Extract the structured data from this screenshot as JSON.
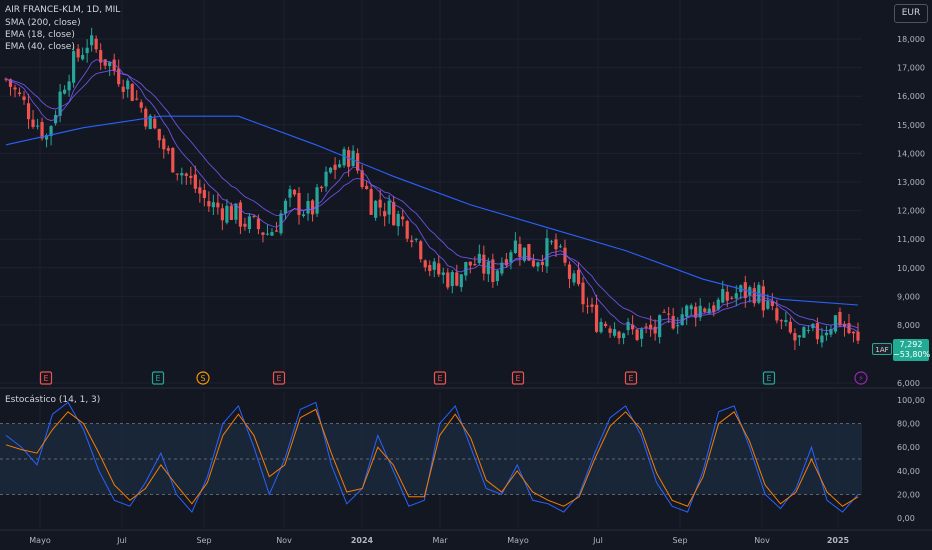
{
  "header": {
    "symbol_line": "AIR FRANCE-KLM, 1D, MIL",
    "indicators": [
      "SMA (200, close)",
      "EMA (18, close)",
      "EMA (40, close)"
    ],
    "currency_button": "EUR"
  },
  "price_tag": {
    "symbol": "1AF",
    "last_price": "7,292",
    "change": "−53,80%",
    "color": "#22ab94"
  },
  "oscillator": {
    "title": "Estocástico (14, 1, 3)",
    "bands": [
      80,
      50,
      20
    ],
    "axis_labels": [
      "100,00",
      "80,00",
      "60,00",
      "40,00",
      "20,00",
      "0,00"
    ]
  },
  "colors": {
    "background": "#131722",
    "up": "#26a69a",
    "down": "#ef5350",
    "sma200": "#2962ff",
    "ema": "#7b5cff",
    "stoch_k": "#2962ff",
    "stoch_d": "#f57c00",
    "band_fill": "#1c2a3f"
  },
  "events": [
    {
      "label": "E",
      "kind": "earnings-red",
      "date": "Jun 2023"
    },
    {
      "label": "E",
      "kind": "earnings-green",
      "date": "Jul 2023"
    },
    {
      "label": "S",
      "kind": "split",
      "date": "Aug 2023"
    },
    {
      "label": "E",
      "kind": "earnings-red",
      "date": "Oct 2023"
    },
    {
      "label": "E",
      "kind": "earnings-red",
      "date": "Feb 2024"
    },
    {
      "label": "E",
      "kind": "earnings-red",
      "date": "Apr 2024"
    },
    {
      "label": "E",
      "kind": "earnings-red",
      "date": "Jul 2024"
    },
    {
      "label": "E",
      "kind": "earnings-green",
      "date": "Oct 2024"
    },
    {
      "label": "⚡",
      "kind": "upcoming",
      "date": "Jan 2025"
    }
  ],
  "chart_data": [
    {
      "type": "candlestick",
      "title": "AIR FRANCE-KLM, 1D, MIL",
      "x_ticks": [
        "Mayo",
        "Jul",
        "Sep",
        "Nov",
        "2024",
        "Mar",
        "Mayo",
        "Jul",
        "Sep",
        "Nov",
        "2025"
      ],
      "y_ticks": [
        "18,000",
        "17,000",
        "16,000",
        "15,000",
        "14,000",
        "13,000",
        "12,000",
        "11,000",
        "10,000",
        "9,000",
        "8,000",
        "6,000"
      ],
      "ylim": [
        6,
        18.6
      ],
      "close_points": [
        {
          "month": "2023-04",
          "close": 16.6
        },
        {
          "month": "2023-04b",
          "close": 15.6
        },
        {
          "month": "2023-05",
          "close": 14.6
        },
        {
          "month": "2023-05b",
          "close": 16.8
        },
        {
          "month": "2023-06",
          "close": 17.9
        },
        {
          "month": "2023-06b",
          "close": 17.2
        },
        {
          "month": "2023-07",
          "close": 16.4
        },
        {
          "month": "2023-07b",
          "close": 15.2
        },
        {
          "month": "2023-08",
          "close": 13.9
        },
        {
          "month": "2023-08b",
          "close": 13.1
        },
        {
          "month": "2023-09",
          "close": 12.2
        },
        {
          "month": "2023-09b",
          "close": 12.0
        },
        {
          "month": "2023-10",
          "close": 11.5
        },
        {
          "month": "2023-10b",
          "close": 11.2
        },
        {
          "month": "2023-11",
          "close": 12.4
        },
        {
          "month": "2023-11b",
          "close": 11.9
        },
        {
          "month": "2023-12",
          "close": 13.4
        },
        {
          "month": "2023-12b",
          "close": 14.0
        },
        {
          "month": "2024-01",
          "close": 12.3
        },
        {
          "month": "2024-01b",
          "close": 12.0
        },
        {
          "month": "2024-02",
          "close": 11.3
        },
        {
          "month": "2024-02b",
          "close": 9.9
        },
        {
          "month": "2024-03",
          "close": 9.6
        },
        {
          "month": "2024-03b",
          "close": 10.2
        },
        {
          "month": "2024-04",
          "close": 9.8
        },
        {
          "month": "2024-04b",
          "close": 10.9
        },
        {
          "month": "2024-05",
          "close": 10.3
        },
        {
          "month": "2024-05b",
          "close": 10.8
        },
        {
          "month": "2024-06",
          "close": 9.4
        },
        {
          "month": "2024-06b",
          "close": 8.2
        },
        {
          "month": "2024-07",
          "close": 8.0
        },
        {
          "month": "2024-07b",
          "close": 7.7
        },
        {
          "month": "2024-08",
          "close": 7.8
        },
        {
          "month": "2024-08b",
          "close": 8.3
        },
        {
          "month": "2024-09",
          "close": 8.6
        },
        {
          "month": "2024-09b",
          "close": 8.7
        },
        {
          "month": "2024-10",
          "close": 9.1
        },
        {
          "month": "2024-10b",
          "close": 9.2
        },
        {
          "month": "2024-11",
          "close": 8.1
        },
        {
          "month": "2024-11b",
          "close": 7.4
        },
        {
          "month": "2024-12",
          "close": 7.7
        },
        {
          "month": "2024-12b",
          "close": 8.3
        },
        {
          "month": "2025-01",
          "close": 7.3
        }
      ],
      "sma200": [
        {
          "month": "2023-04",
          "value": 14.3
        },
        {
          "month": "2023-06",
          "value": 14.9
        },
        {
          "month": "2023-08",
          "value": 15.3
        },
        {
          "month": "2023-10",
          "value": 15.3
        },
        {
          "month": "2023-12",
          "value": 14.3
        },
        {
          "month": "2024-02",
          "value": 13.2
        },
        {
          "month": "2024-04",
          "value": 12.2
        },
        {
          "month": "2024-06",
          "value": 11.4
        },
        {
          "month": "2024-08",
          "value": 10.6
        },
        {
          "month": "2024-10",
          "value": 9.6
        },
        {
          "month": "2024-12",
          "value": 8.9
        },
        {
          "month": "2025-01",
          "value": 8.7
        }
      ]
    },
    {
      "type": "line",
      "title": "Estocástico (14, 1, 3)",
      "y_ticks": [
        "100,00",
        "80,00",
        "60,00",
        "40,00",
        "20,00",
        "0,00"
      ],
      "ylim": [
        0,
        100
      ],
      "series": [
        {
          "name": "%K",
          "values": [
            70,
            60,
            45,
            88,
            98,
            75,
            40,
            15,
            10,
            30,
            55,
            20,
            5,
            35,
            80,
            95,
            60,
            20,
            50,
            92,
            98,
            45,
            12,
            25,
            70,
            40,
            10,
            15,
            80,
            95,
            60,
            25,
            20,
            45,
            15,
            12,
            5,
            20,
            55,
            85,
            95,
            70,
            30,
            10,
            5,
            40,
            90,
            95,
            60,
            20,
            8,
            25,
            60,
            15,
            5,
            20
          ]
        },
        {
          "name": "%D",
          "values": [
            62,
            58,
            55,
            75,
            90,
            80,
            55,
            28,
            15,
            25,
            45,
            28,
            12,
            30,
            70,
            88,
            70,
            35,
            45,
            85,
            92,
            55,
            22,
            25,
            60,
            45,
            18,
            18,
            70,
            88,
            68,
            32,
            22,
            40,
            22,
            15,
            10,
            18,
            50,
            78,
            90,
            75,
            38,
            15,
            10,
            35,
            80,
            90,
            65,
            28,
            12,
            22,
            50,
            22,
            10,
            18
          ]
        }
      ]
    }
  ]
}
